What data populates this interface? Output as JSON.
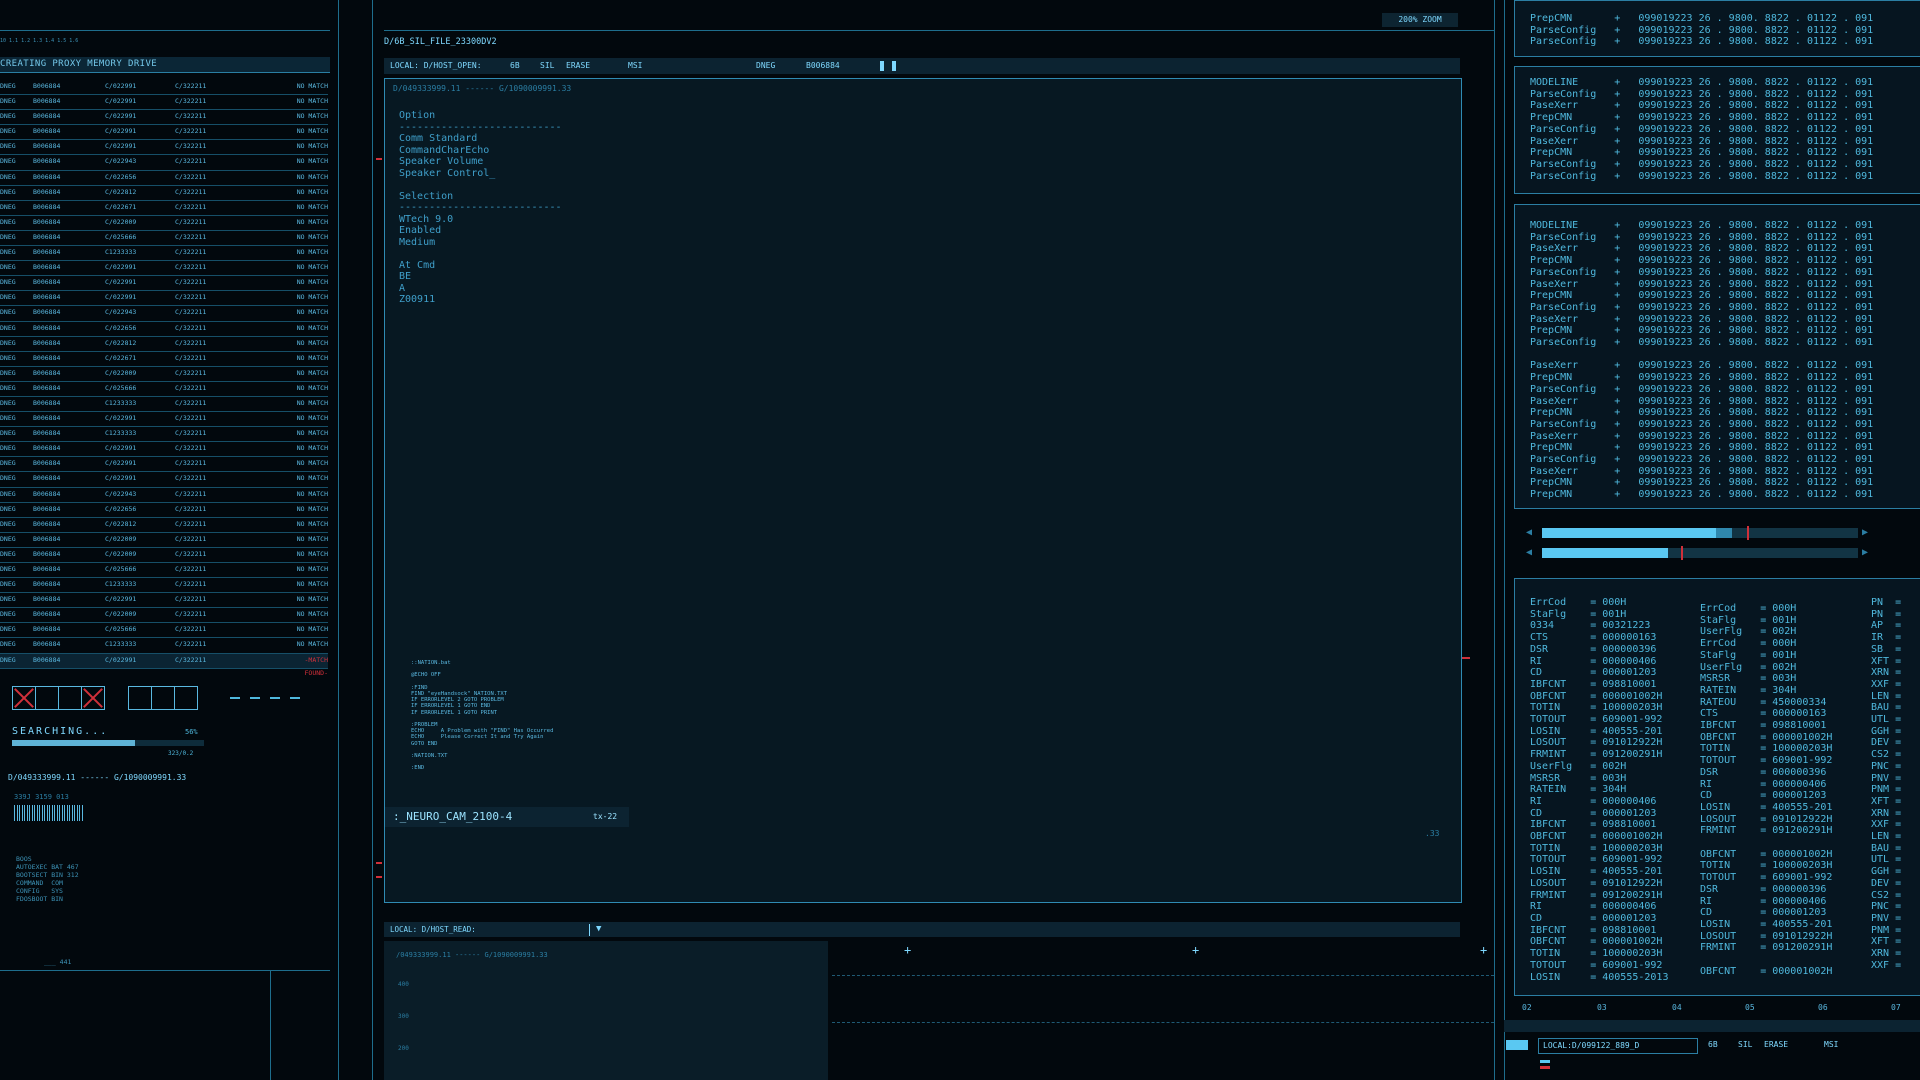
{
  "left": {
    "ruler": "10   1.1   1.2   1.3   1.4   1.5   1.6",
    "memory_title": "CREATING PROXY MEMORY DRIVE",
    "rows": [
      [
        "DNEG",
        "B006884",
        "C/022991",
        "C/322211",
        "NO MATCH"
      ],
      [
        "DNEG",
        "B006884",
        "C/022991",
        "C/322211",
        "NO MATCH"
      ],
      [
        "DNEG",
        "B006884",
        "C/022991",
        "C/322211",
        "NO MATCH"
      ],
      [
        "DNEG",
        "B006884",
        "C/022991",
        "C/322211",
        "NO MATCH"
      ],
      [
        "DNEG",
        "B006884",
        "C/022991",
        "C/322211",
        "NO MATCH"
      ],
      [
        "DNEG",
        "B006884",
        "C/022943",
        "C/322211",
        "NO MATCH"
      ],
      [
        "DNEG",
        "B006884",
        "C/022656",
        "C/322211",
        "NO MATCH"
      ],
      [
        "DNEG",
        "B006884",
        "C/022812",
        "C/322211",
        "NO MATCH"
      ],
      [
        "DNEG",
        "B006884",
        "C/022671",
        "C/322211",
        "NO MATCH"
      ],
      [
        "DNEG",
        "B006884",
        "C/022009",
        "C/322211",
        "NO MATCH"
      ],
      [
        "DNEG",
        "B006884",
        "C/025666",
        "C/322211",
        "NO MATCH"
      ],
      [
        "DNEG",
        "B006884",
        "C1233333",
        "C/322211",
        "NO MATCH"
      ],
      [
        "DNEG",
        "B006884",
        "C/022991",
        "C/322211",
        "NO MATCH"
      ],
      [
        "DNEG",
        "B006884",
        "C/022991",
        "C/322211",
        "NO MATCH"
      ],
      [
        "DNEG",
        "B006884",
        "C/022991",
        "C/322211",
        "NO MATCH"
      ],
      [
        "DNEG",
        "B006884",
        "C/022943",
        "C/322211",
        "NO MATCH"
      ],
      [
        "DNEG",
        "B006884",
        "C/022656",
        "C/322211",
        "NO MATCH"
      ],
      [
        "DNEG",
        "B006884",
        "C/022812",
        "C/322211",
        "NO MATCH"
      ],
      [
        "DNEG",
        "B006884",
        "C/022671",
        "C/322211",
        "NO MATCH"
      ],
      [
        "DNEG",
        "B006884",
        "C/022009",
        "C/322211",
        "NO MATCH"
      ],
      [
        "DNEG",
        "B006884",
        "C/025666",
        "C/322211",
        "NO MATCH"
      ],
      [
        "DNEG",
        "B006884",
        "C1233333",
        "C/322211",
        "NO MATCH"
      ],
      [
        "DNEG",
        "B006884",
        "C/022991",
        "C/322211",
        "NO MATCH"
      ],
      [
        "DNEG",
        "B006884",
        "C1233333",
        "C/322211",
        "NO MATCH"
      ],
      [
        "DNEG",
        "B006884",
        "C/022991",
        "C/322211",
        "NO MATCH"
      ],
      [
        "DNEG",
        "B006884",
        "C/022991",
        "C/322211",
        "NO MATCH"
      ],
      [
        "DNEG",
        "B006884",
        "C/022991",
        "C/322211",
        "NO MATCH"
      ],
      [
        "DNEG",
        "B006884",
        "C/022943",
        "C/322211",
        "NO MATCH"
      ],
      [
        "DNEG",
        "B006884",
        "C/022656",
        "C/322211",
        "NO MATCH"
      ],
      [
        "DNEG",
        "B006884",
        "C/022812",
        "C/322211",
        "NO MATCH"
      ],
      [
        "DNEG",
        "B006884",
        "C/022009",
        "C/322211",
        "NO MATCH"
      ],
      [
        "DNEG",
        "B006884",
        "C/022009",
        "C/322211",
        "NO MATCH"
      ],
      [
        "DNEG",
        "B006884",
        "C/025666",
        "C/322211",
        "NO MATCH"
      ],
      [
        "DNEG",
        "B006884",
        "C1233333",
        "C/322211",
        "NO MATCH"
      ],
      [
        "DNEG",
        "B006884",
        "C/022991",
        "C/322211",
        "NO MATCH"
      ],
      [
        "DNEG",
        "B006884",
        "C/022009",
        "C/322211",
        "NO MATCH"
      ],
      [
        "DNEG",
        "B006884",
        "C/025666",
        "C/322211",
        "NO MATCH"
      ],
      [
        "DNEG",
        "B006884",
        "C1233333",
        "C/322211",
        "NO MATCH"
      ]
    ],
    "found_row": [
      "DNEG",
      "B006884",
      "C/022991",
      "C/322211",
      "-MATCH FOUND-"
    ],
    "search_label": "SEARCHING...",
    "search_percent": "56%",
    "search_progress": 0.64,
    "search_sub": "323/0.2",
    "address": "D/049333999.11 ------ G/1090009991.33",
    "meta": "339J 3159 013",
    "boot_list": "BOOS\nAUTOEXEC BAT 467\nBOOTSECT BIN 312\nCOMMAND  COM\nCONFIG   SYS\nFDOSBOOT BIN",
    "footer": "___  441"
  },
  "center": {
    "file_title": "D/6B_SIL_FILE_23300DV2",
    "zoom": "200% ZOOM",
    "toolbar": {
      "local": "LOCAL: D/HOST_OPEN:",
      "f1": "6B",
      "f2": "SIL",
      "f3": "ERASE",
      "f4": "MSI",
      "f5": "DNEG",
      "f6": "B006884"
    },
    "path": "D/049333999.11 ------ G/1090009991.33",
    "editor_text": "Option\n---------------------------\nComm Standard\nCommandCharEcho\nSpeaker Volume\nSpeaker Control_\n\nSelection\n---------------------------\nWTech 9.0\nEnabled\nMedium\n\nAt Cmd\nBE\nA\nZ00911",
    "script_text": "::NATION.bat\n\n@ECHO OFF\n\n:FIND\nFIND \"eyeHandsock\" NATION.TXT\nIF ERRORLEVEL 2 GOTO PROBLEM\nIF ERRORLEVEL 1 GOTO END\nIF ERRORLEVEL 1 GOTO PRINT\n\n:PROBLEM\nECHO     A Problem with \"FIND\" Has Occurred\nECHO     Please Correct It and Try Again\nGOTO END\n\n:NATION.TXT\n\n:END",
    "cam_label": ":_NEURO_CAM_2100-4",
    "cam_tag": "tx-22",
    "corner_num": ".33",
    "read_label": "LOCAL: D/HOST_READ:",
    "read_path": "/049333999.11 ------ G/1090009991.33",
    "read_ticks": [
      "400",
      "300",
      "200"
    ]
  },
  "right": {
    "panel1": "PrepCMN       +   099019223 26 . 9800. 8822 . 01122 . 091\nParseConfig   +   099019223 26 . 9800. 8822 . 01122 . 091\nParseConfig   +   099019223 26 . 9800. 8822 . 01122 . 091",
    "panel2": "MODELINE      +   099019223 26 . 9800. 8822 . 01122 . 091\nParseConfig   +   099019223 26 . 9800. 8822 . 01122 . 091\nPaseXerr      +   099019223 26 . 9800. 8822 . 01122 . 091\nPrepCMN       +   099019223 26 . 9800. 8822 . 01122 . 091\nParseConfig   +   099019223 26 . 9800. 8822 . 01122 . 091\nPaseXerr      +   099019223 26 . 9800. 8822 . 01122 . 091\nPrepCMN       +   099019223 26 . 9800. 8822 . 01122 . 091\nParseConfig   +   099019223 26 . 9800. 8822 . 01122 . 091\nParseConfig   +   099019223 26 . 9800. 8822 . 01122 . 091",
    "panel3": "MODELINE      +   099019223 26 . 9800. 8822 . 01122 . 091\nParseConfig   +   099019223 26 . 9800. 8822 . 01122 . 091\nPaseXerr      +   099019223 26 . 9800. 8822 . 01122 . 091\nPrepCMN       +   099019223 26 . 9800. 8822 . 01122 . 091\nParseConfig   +   099019223 26 . 9800. 8822 . 01122 . 091\nPaseXerr      +   099019223 26 . 9800. 8822 . 01122 . 091\nPrepCMN       +   099019223 26 . 9800. 8822 . 01122 . 091\nParseConfig   +   099019223 26 . 9800. 8822 . 01122 . 091\nPaseXerr      +   099019223 26 . 9800. 8822 . 01122 . 091\nPrepCMN       +   099019223 26 . 9800. 8822 . 01122 . 091\nParseConfig   +   099019223 26 . 9800. 8822 . 01122 . 091\n\nPaseXerr      +   099019223 26 . 9800. 8822 . 01122 . 091\nPrepCMN       +   099019223 26 . 9800. 8822 . 01122 . 091\nParseConfig   +   099019223 26 . 9800. 8822 . 01122 . 091\nPaseXerr      +   099019223 26 . 9800. 8822 . 01122 . 091\nPrepCMN       +   099019223 26 . 9800. 8822 . 01122 . 091\nParseConfig   +   099019223 26 . 9800. 8822 . 01122 . 091\nPaseXerr      +   099019223 26 . 9800. 8822 . 01122 . 091\nPrepCMN       +   099019223 26 . 9800. 8822 . 01122 . 091\nParseConfig   +   099019223 26 . 9800. 8822 . 01122 . 091\nPaseXerr      +   099019223 26 . 9800. 8822 . 01122 . 091\nPrepCMN       +   099019223 26 . 9800. 8822 . 01122 . 091\nPrepCMN       +   099019223 26 . 9800. 8822 . 01122 . 091",
    "slider1": {
      "fill": 0.55,
      "second": 0.6,
      "mark": 0.65
    },
    "slider2": {
      "fill": 0.4,
      "mark": 0.44
    },
    "err_a": "ErrCod    = 000H\nStaFlg    = 001H\n0334      = 00321223\nCTS       = 000000163\nDSR       = 000000396\nRI        = 000000406\nCD        = 000001203\nIBFCNT    = 098810001\nOBFCNT    = 000001002H\nTOTIN     = 100000203H\nTOTOUT    = 609001-992\nLOSIN     = 400555-201\nLOSOUT    = 091012922H\nFRMINT    = 091200291H\nUserFlg   = 002H\nMSRSR     = 003H\nRATEIN    = 304H\nRI        = 000000406\nCD        = 000001203\nIBFCNT    = 098810001\nOBFCNT    = 000001002H\nTOTIN     = 100000203H\nTOTOUT    = 609001-992\nLOSIN     = 400555-201\nLOSOUT    = 091012922H\nFRMINT    = 091200291H\nRI        = 000000406\nCD        = 000001203\nIBFCNT    = 098810001\nOBFCNT    = 000001002H\nTOTIN     = 100000203H\nTOTOUT    = 609001-992\nLOSIN     = 400555-2013",
    "err_b": "ErrCod    = 000H\nStaFlg    = 001H\nUserFlg   = 002H\nErrCod    = 000H\nStaFlg    = 001H\nUserFlg   = 002H\nMSRSR     = 003H\nRATEIN    = 304H\nRATEOU    = 450000334\nCTS       = 000000163\nIBFCNT    = 098810001\nOBFCNT    = 000001002H\nTOTIN     = 100000203H\nTOTOUT    = 609001-992\nDSR       = 000000396\nRI        = 000000406\nCD        = 000001203\nLOSIN     = 400555-201\nLOSOUT    = 091012922H\nFRMINT    = 091200291H\n\nOBFCNT    = 000001002H\nTOTIN     = 100000203H\nTOTOUT    = 609001-992\nDSR       = 000000396\nRI        = 000000406\nCD        = 000001203\nLOSIN     = 400555-201\nLOSOUT    = 091012922H\nFRMINT    = 091200291H\n\nOBFCNT    = 000001002H",
    "err_c": "PN  =\nPN  =\nAP  =\nIR  =\nSB  =\nXFT =\nXRN =\nXXF =\nLEN =\nBAU =\nUTL =\nGGH =\nDEV =\nCS2 =\nPNC =\nPNV =\nPNM =\nXFT =\nXRN =\nXXF =\nLEN =\nBAU =\nUTL =\nGGH =\nDEV =\nCS2 =\nPNC =\nPNV =\nPNM =\nXFT =\nXRN =\nXXF =",
    "scale": [
      "02",
      "03",
      "04",
      "05",
      "06",
      "07"
    ],
    "bottom": {
      "local": "LOCAL:D/099122_889_D",
      "f1": "6B",
      "f2": "SIL",
      "f3": "ERASE",
      "f4": "MSI"
    }
  },
  "colors": {
    "accent": "#4fb8dd",
    "bright": "#7fd9ff",
    "alert": "#d0303a",
    "background": "#02080d"
  }
}
